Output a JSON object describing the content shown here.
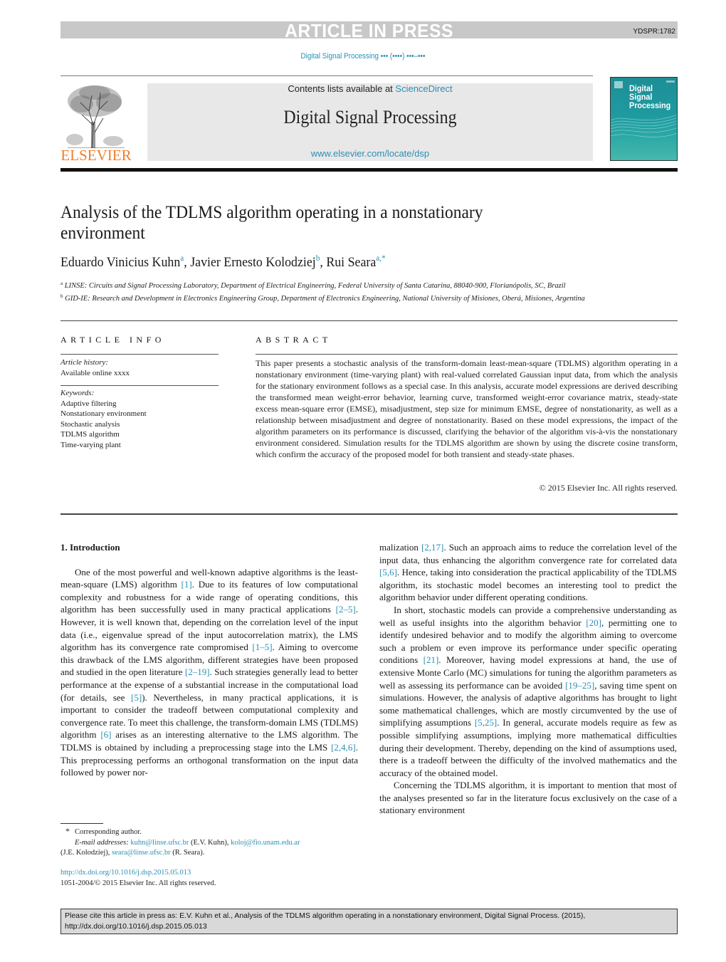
{
  "banner": {
    "label": "ARTICLE IN PRESS",
    "doc_id": "YDSPR:1782",
    "journal_ref": "Digital Signal Processing ••• (••••) •••–•••"
  },
  "masthead": {
    "publisher": "ELSEVIER",
    "contents_prefix": "Contents lists available at ",
    "contents_link": "ScienceDirect",
    "journal_title": "Digital Signal Processing",
    "journal_url": "www.elsevier.com/locate/dsp",
    "cover_title_lines": [
      "Digital",
      "Signal",
      "Processing"
    ]
  },
  "article": {
    "title": "Analysis of the TDLMS algorithm operating in a nonstationary environment",
    "authors": [
      {
        "name": "Eduardo Vinicius Kuhn",
        "marks": "a"
      },
      {
        "name": "Javier Ernesto Kolodziej",
        "marks": "b"
      },
      {
        "name": "Rui Seara",
        "marks": "a,*"
      }
    ],
    "affiliations": [
      {
        "mark": "a",
        "text": "LINSE: Circuits and Signal Processing Laboratory, Department of Electrical Engineering, Federal University of Santa Catarina, 88040-900, Florianópolis, SC, Brazil"
      },
      {
        "mark": "b",
        "text": "GID-IE: Research and Development in Electronics Engineering Group, Department of Electronics Engineering, National University of Misiones, Oberá, Misiones, Argentina"
      }
    ]
  },
  "article_info": {
    "heading": "ARTICLE INFO",
    "history_label": "Article history:",
    "history_value": "Available online xxxx",
    "keywords_label": "Keywords:",
    "keywords": [
      "Adaptive filtering",
      "Nonstationary environment",
      "Stochastic analysis",
      "TDLMS algorithm",
      "Time-varying plant"
    ]
  },
  "abstract": {
    "heading": "ABSTRACT",
    "text": "This paper presents a stochastic analysis of the transform-domain least-mean-square (TDLMS) algorithm operating in a nonstationary environment (time-varying plant) with real-valued correlated Gaussian input data, from which the analysis for the stationary environment follows as a special case. In this analysis, accurate model expressions are derived describing the transformed mean weight-error behavior, learning curve, transformed weight-error covariance matrix, steady-state excess mean-square error (EMSE), misadjustment, step size for minimum EMSE, degree of nonstationarity, as well as a relationship between misadjustment and degree of nonstationarity. Based on these model expressions, the impact of the algorithm parameters on its performance is discussed, clarifying the behavior of the algorithm vis-à-vis the nonstationary environment considered. Simulation results for the TDLMS algorithm are shown by using the discrete cosine transform, which confirm the accuracy of the proposed model for both transient and steady-state phases.",
    "copyright": "© 2015 Elsevier Inc. All rights reserved."
  },
  "body": {
    "section_title": "1. Introduction",
    "left_paragraph": [
      {
        "t": "One of the most powerful and well-known adaptive algorithms is the least-mean-square (LMS) algorithm "
      },
      {
        "c": "[1]"
      },
      {
        "t": ". Due to its features of low computational complexity and robustness for a wide range of operating conditions, this algorithm has been successfully used in many practical applications "
      },
      {
        "c": "[2–5]"
      },
      {
        "t": ". However, it is well known that, depending on the correlation level of the input data (i.e., eigenvalue spread of the input autocorrelation matrix), the LMS algorithm has its convergence rate compromised "
      },
      {
        "c": "[1–5]"
      },
      {
        "t": ". Aiming to overcome this drawback of the LMS algorithm, different strategies have been proposed and studied in the open literature "
      },
      {
        "c": "[2–19]"
      },
      {
        "t": ". Such strategies generally lead to better performance at the expense of a substantial increase in the computational load (for details, see "
      },
      {
        "c": "[5]"
      },
      {
        "t": "). Nevertheless, in many practical applications, it is important to consider the tradeoff between computational complexity and convergence rate. To meet this challenge, the transform-domain LMS (TDLMS) algorithm "
      },
      {
        "c": "[6]"
      },
      {
        "t": " arises as an interesting alternative to the LMS algorithm. The TDLMS is obtained by including a preprocessing stage into the LMS "
      },
      {
        "c": "[2,4,6]"
      },
      {
        "t": ". This preprocessing performs an orthogonal transformation on the input data followed by power nor-"
      }
    ],
    "right_paragraphs": [
      [
        {
          "t": "malization "
        },
        {
          "c": "[2,17]"
        },
        {
          "t": ". Such an approach aims to reduce the correlation level of the input data, thus enhancing the algorithm convergence rate for correlated data "
        },
        {
          "c": "[5,6]"
        },
        {
          "t": ". Hence, taking into consideration the practical applicability of the TDLMS algorithm, its stochastic model becomes an interesting tool to predict the algorithm behavior under different operating conditions."
        }
      ],
      [
        {
          "t": "In short, stochastic models can provide a comprehensive understanding as well as useful insights into the algorithm behavior "
        },
        {
          "c": "[20]"
        },
        {
          "t": ", permitting one to identify undesired behavior and to modify the algorithm aiming to overcome such a problem or even improve its performance under specific operating conditions "
        },
        {
          "c": "[21]"
        },
        {
          "t": ". Moreover, having model expressions at hand, the use of extensive Monte Carlo (MC) simulations for tuning the algorithm parameters as well as assessing its performance can be avoided "
        },
        {
          "c": "[19–25]"
        },
        {
          "t": ", saving time spent on simulations. However, the analysis of adaptive algorithms has brought to light some mathematical challenges, which are mostly circumvented by the use of simplifying assumptions "
        },
        {
          "c": "[5,25]"
        },
        {
          "t": ". In general, accurate models require as few as possible simplifying assumptions, implying more mathematical difficulties during their development. Thereby, depending on the kind of assumptions used, there is a tradeoff between the difficulty of the involved mathematics and the accuracy of the obtained model."
        }
      ],
      [
        {
          "t": "Concerning the TDLMS algorithm, it is important to mention that most of the analyses presented so far in the literature focus exclusively on the case of a stationary environment"
        }
      ]
    ]
  },
  "footnotes": {
    "star": "*",
    "corresponding": "Corresponding author.",
    "email_label": "E-mail addresses:",
    "emails": [
      {
        "address": "kuhn@linse.ufsc.br",
        "owner": "(E.V. Kuhn),"
      },
      {
        "address": "koloj@fio.unam.edu.ar",
        "owner": "(J.E. Kolodziej),"
      },
      {
        "address": "seara@linse.ufsc.br",
        "owner": "(R. Seara)."
      }
    ],
    "doi": "http://dx.doi.org/10.1016/j.dsp.2015.05.013",
    "issn_copyright": "1051-2004/© 2015 Elsevier Inc. All rights reserved."
  },
  "cite_box": {
    "line1": "Please cite this article in press as: E.V. Kuhn et al., Analysis of the TDLMS algorithm operating in a nonstationary environment, Digital Signal Process. (2015),",
    "line2": "http://dx.doi.org/10.1016/j.dsp.2015.05.013"
  },
  "colors": {
    "link": "#2b8fb5",
    "publisher_orange": "#f07e28",
    "banner_gray": "#c8c8c8",
    "masthead_gray": "#e8e8e8",
    "cover_teal": "#1e9aa0",
    "cite_box_gray": "#d9d9d9"
  }
}
